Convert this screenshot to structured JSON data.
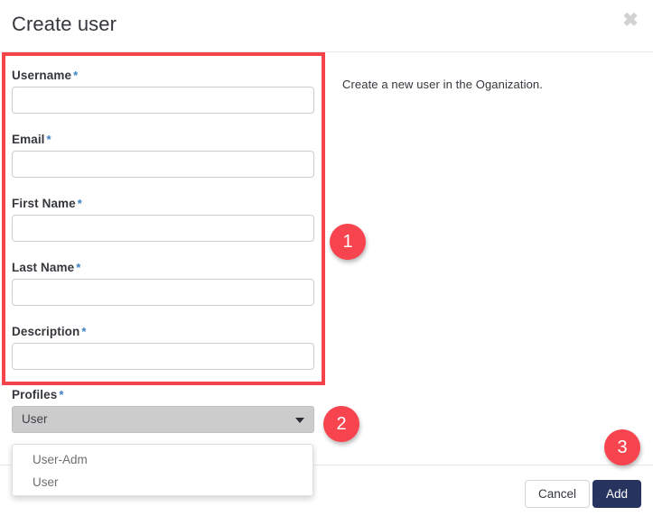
{
  "modal": {
    "title": "Create user",
    "close_icon": "close-icon",
    "info_text": "Create a new user in the Oganization."
  },
  "form": {
    "required_marker": "*",
    "fields": [
      {
        "label": "Username",
        "value": "",
        "placeholder": ""
      },
      {
        "label": "Email",
        "value": "",
        "placeholder": ""
      },
      {
        "label": "First Name",
        "value": "",
        "placeholder": ""
      },
      {
        "label": "Last Name",
        "value": "",
        "placeholder": ""
      },
      {
        "label": "Description",
        "value": "",
        "placeholder": ""
      }
    ],
    "profiles": {
      "label": "Profiles",
      "selected": "User",
      "options": [
        "User-Adm",
        "User"
      ],
      "expanded": true
    }
  },
  "footer": {
    "cancel_label": "Cancel",
    "add_label": "Add"
  },
  "annotations": {
    "badges": [
      {
        "number": "1"
      },
      {
        "number": "2"
      },
      {
        "number": "3"
      }
    ],
    "highlight_color": "#f4434a",
    "badge_color": "#f7444e"
  }
}
